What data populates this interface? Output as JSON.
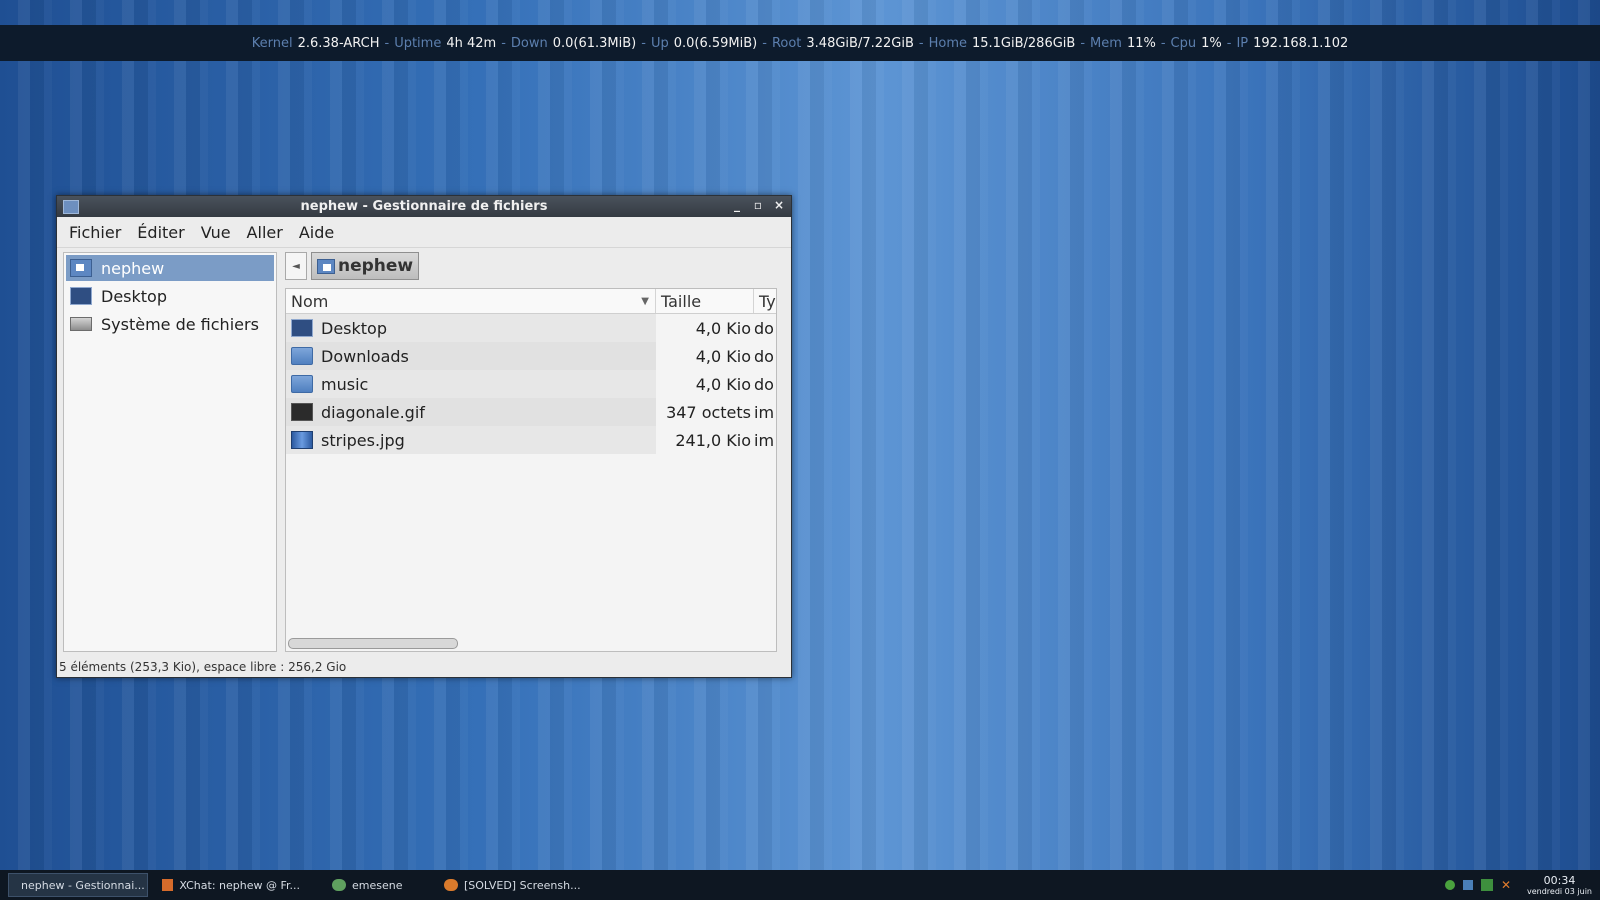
{
  "topbar": {
    "items": [
      {
        "label": "Kernel",
        "value": "2.6.38-ARCH"
      },
      {
        "label": "Uptime",
        "value": "4h 42m"
      },
      {
        "label": "Down",
        "value": "0.0(61.3MiB)"
      },
      {
        "label": "Up",
        "value": "0.0(6.59MiB)"
      },
      {
        "label": "Root",
        "value": "3.48GiB/7.22GiB"
      },
      {
        "label": "Home",
        "value": "15.1GiB/286GiB"
      },
      {
        "label": "Mem",
        "value": "11%"
      },
      {
        "label": "Cpu",
        "value": "1%"
      },
      {
        "label": "IP",
        "value": "192.168.1.102"
      }
    ],
    "separator": "-"
  },
  "window": {
    "title": "nephew - Gestionnaire de fichiers",
    "controls": {
      "minimize": "_",
      "maximize": "▫",
      "close": "×"
    },
    "menu": [
      "Fichier",
      "Éditer",
      "Vue",
      "Aller",
      "Aide"
    ],
    "sidebar": [
      {
        "label": "nephew",
        "icon": "home-folder-icon",
        "selected": true
      },
      {
        "label": "Desktop",
        "icon": "desktop-icon",
        "selected": false
      },
      {
        "label": "Système de fichiers",
        "icon": "drive-icon",
        "selected": false
      }
    ],
    "pathbar": {
      "back": "◄",
      "current": "nephew"
    },
    "columns": {
      "name": "Nom",
      "size": "Taille",
      "type": "Ty",
      "sort_indicator": "▼"
    },
    "files": [
      {
        "name": "Desktop",
        "size": "4,0 Kio",
        "type": "do",
        "icon": "desktop-icon"
      },
      {
        "name": "Downloads",
        "size": "4,0 Kio",
        "type": "do",
        "icon": "folder-icon"
      },
      {
        "name": "music",
        "size": "4,0 Kio",
        "type": "do",
        "icon": "folder-icon"
      },
      {
        "name": "diagonale.gif",
        "size": "347 octets",
        "type": "im",
        "icon": "image-gif-icon"
      },
      {
        "name": "stripes.jpg",
        "size": "241,0 Kio",
        "type": "im",
        "icon": "image-jpg-icon"
      }
    ],
    "status": "5 éléments (253,3 Kio), espace libre : 256,2 Gio"
  },
  "taskbar": {
    "tasks": [
      {
        "label": "nephew - Gestionnai...",
        "icon": "file-manager-icon",
        "active": true
      },
      {
        "label": "XChat: nephew @ Fr...",
        "icon": "xchat-icon",
        "active": false
      },
      {
        "label": "emesene",
        "icon": "emesene-icon",
        "active": false
      },
      {
        "label": "[SOLVED] Screensh...",
        "icon": "firefox-icon",
        "active": false
      }
    ],
    "clock": {
      "time": "00:34",
      "date": "vendredi 03 juin"
    }
  }
}
